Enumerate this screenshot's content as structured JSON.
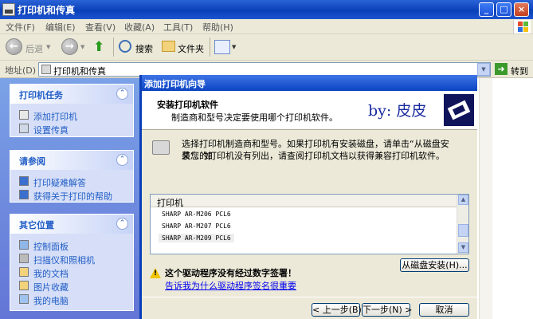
{
  "window": {
    "title": "打印机和传真",
    "controls": [
      "_",
      "□",
      "×"
    ]
  },
  "menu": [
    "文件(F)",
    "编辑(E)",
    "查看(V)",
    "收藏(A)",
    "工具(T)",
    "帮助(H)"
  ],
  "toolbar": {
    "back_label": "后退",
    "search_label": "搜索",
    "folders_label": "文件夹"
  },
  "address": {
    "label": "地址(D)",
    "value": "打印机和传真",
    "go_label": "转到"
  },
  "left_panels": [
    {
      "title": "打印机任务",
      "items": [
        "添加打印机",
        "设置传真"
      ]
    },
    {
      "title": "请参阅",
      "items": [
        "打印疑难解答",
        "获得关于打印的帮助"
      ]
    },
    {
      "title": "其它位置",
      "items": [
        "控制面板",
        "扫描仪和照相机",
        "我的文档",
        "图片收藏",
        "我的电脑"
      ]
    }
  ],
  "wizard": {
    "title": "添加打印机向导",
    "header_title": "安装打印机软件",
    "header_subtitle": "制造商和型号决定要使用哪个打印机软件。",
    "byline": "by: 皮皮",
    "description_line1": "选择打印机制造商和型号。如果打印机有安装磁盘，请单击“从磁盘安装”。如",
    "description_line2": "果您的打印机没有列出，请查阅打印机文档以获得兼容打印机软件。",
    "list_header": "打印机",
    "printers": [
      "SHARP AR-M206 PCL6",
      "SHARP AR-M207 PCL6",
      "SHARP AR-M209 PCL6"
    ],
    "selected_index": 2,
    "have_disk_label": "从磁盘安装(H)...",
    "warning_text": "这个驱动程序没有经过数字签署！",
    "warning_link": "告诉我为什么驱动程序签名很重要",
    "back_label": "< 上一步(B)",
    "next_label": "下一步(N) >",
    "cancel_label": "取消"
  }
}
